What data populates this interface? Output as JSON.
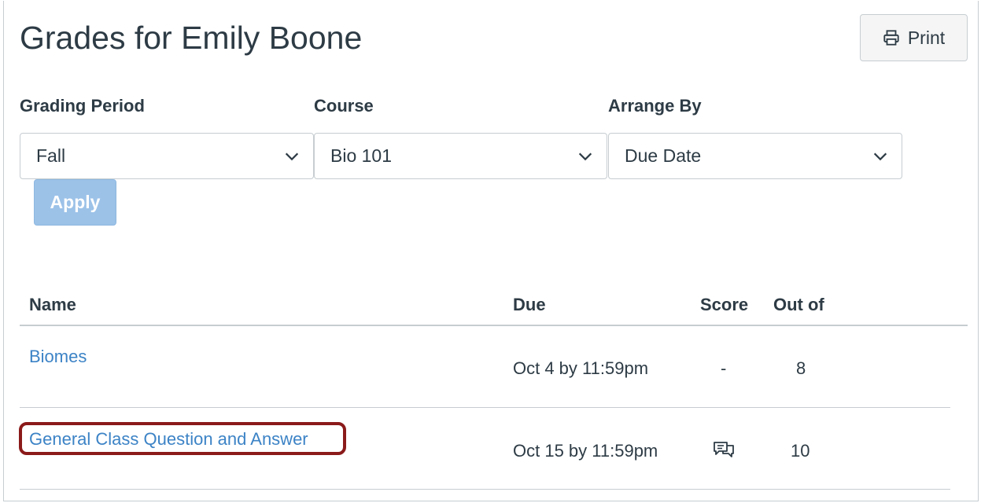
{
  "header": {
    "title": "Grades for Emily Boone",
    "print_label": "Print"
  },
  "filters": {
    "grading_period": {
      "label": "Grading Period",
      "value": "Fall"
    },
    "course": {
      "label": "Course",
      "value": "Bio 101"
    },
    "arrange_by": {
      "label": "Arrange By",
      "value": "Due Date"
    },
    "apply_label": "Apply"
  },
  "table": {
    "columns": [
      "Name",
      "Due",
      "Score",
      "Out of"
    ],
    "rows": [
      {
        "name": "Biomes",
        "due": "Oct 4 by 11:59pm",
        "score": "-",
        "out_of": "8"
      },
      {
        "name": "General Class Question and Answer",
        "due": "Oct 15 by 11:59pm",
        "score_icon": "comment-icon",
        "out_of": "10"
      }
    ]
  },
  "colors": {
    "link": "#3c83c6",
    "apply_disabled": "#9cc2e8",
    "highlight": "#8b1a1a",
    "text": "#2d3b45"
  }
}
